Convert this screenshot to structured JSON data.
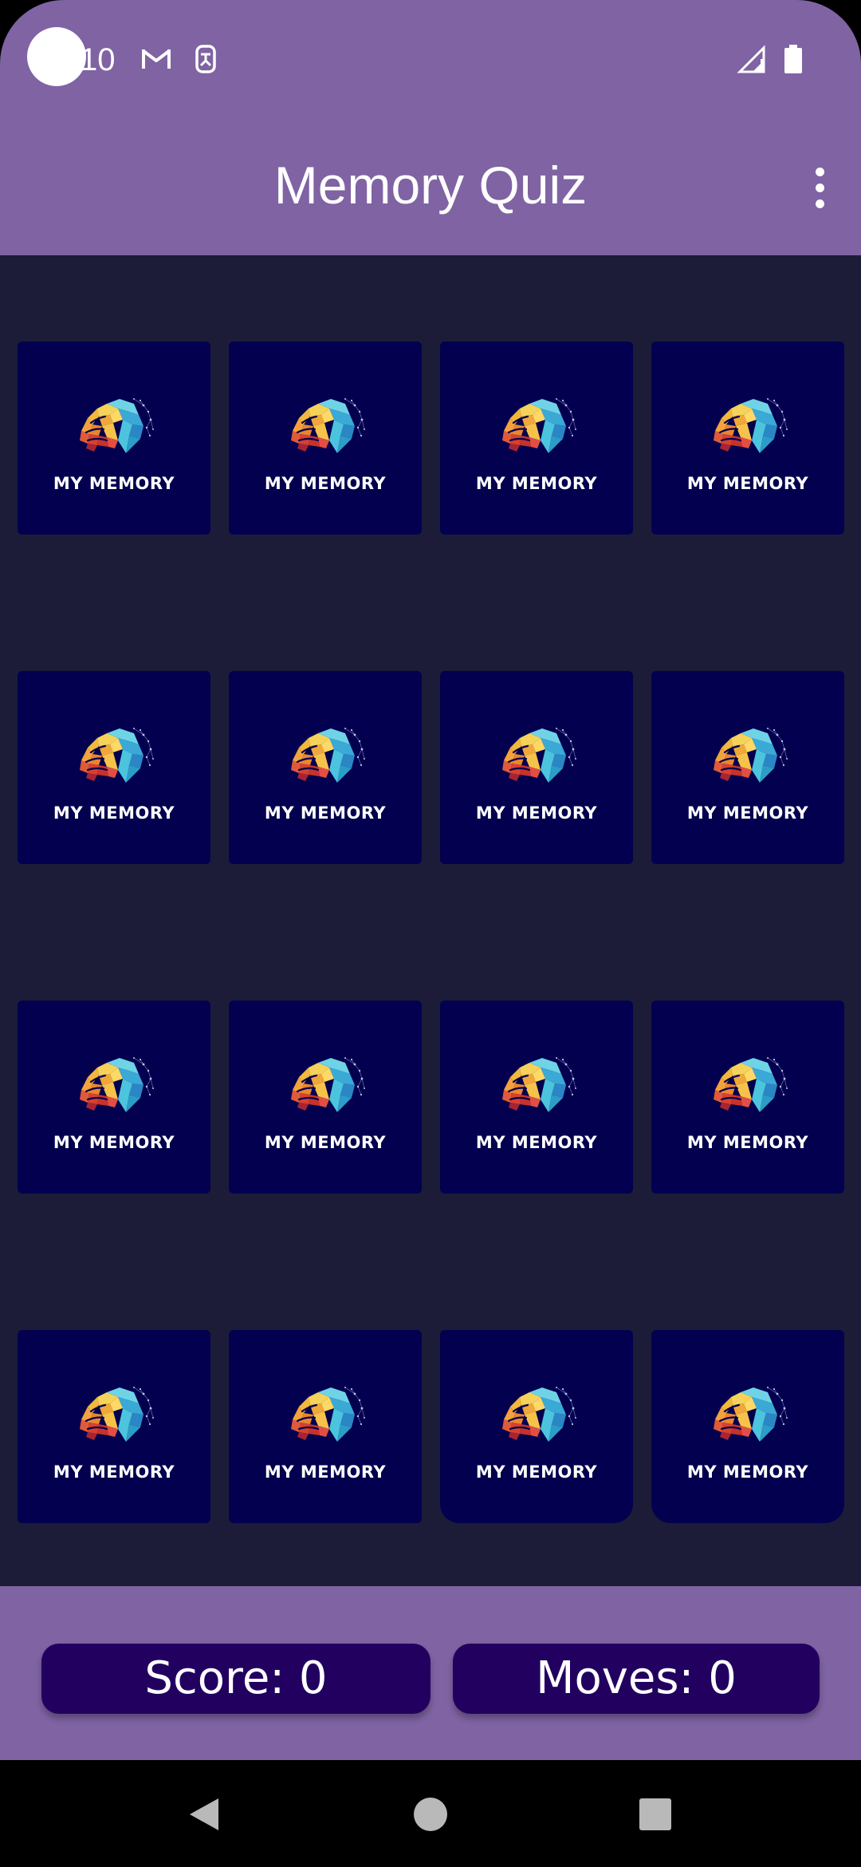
{
  "status_bar": {
    "time": "10",
    "icons": [
      "gmail-icon",
      "sim-icon",
      "signal-icon",
      "battery-icon"
    ]
  },
  "app_bar": {
    "title": "Memory Quiz",
    "menu_icon": "more-vert-icon"
  },
  "board": {
    "rows": 4,
    "columns": 4,
    "card_label": "MY MEMORY",
    "card_icon": "brain-logo-icon",
    "cards": [
      {
        "label": "MY MEMORY"
      },
      {
        "label": "MY MEMORY"
      },
      {
        "label": "MY MEMORY"
      },
      {
        "label": "MY MEMORY"
      },
      {
        "label": "MY MEMORY"
      },
      {
        "label": "MY MEMORY"
      },
      {
        "label": "MY MEMORY"
      },
      {
        "label": "MY MEMORY"
      },
      {
        "label": "MY MEMORY"
      },
      {
        "label": "MY MEMORY"
      },
      {
        "label": "MY MEMORY"
      },
      {
        "label": "MY MEMORY"
      },
      {
        "label": "MY MEMORY"
      },
      {
        "label": "MY MEMORY"
      },
      {
        "label": "MY MEMORY"
      },
      {
        "label": "MY MEMORY"
      }
    ]
  },
  "footer": {
    "score_text": "Score: 0",
    "moves_text": "Moves: 0"
  },
  "nav_bar": {
    "icons": [
      "back-icon",
      "home-icon",
      "recents-icon"
    ]
  },
  "colors": {
    "app_bar": "#7f63a3",
    "board_bg": "#1c1c38",
    "card_bg": "#03004f",
    "pill_bg": "#220060"
  }
}
